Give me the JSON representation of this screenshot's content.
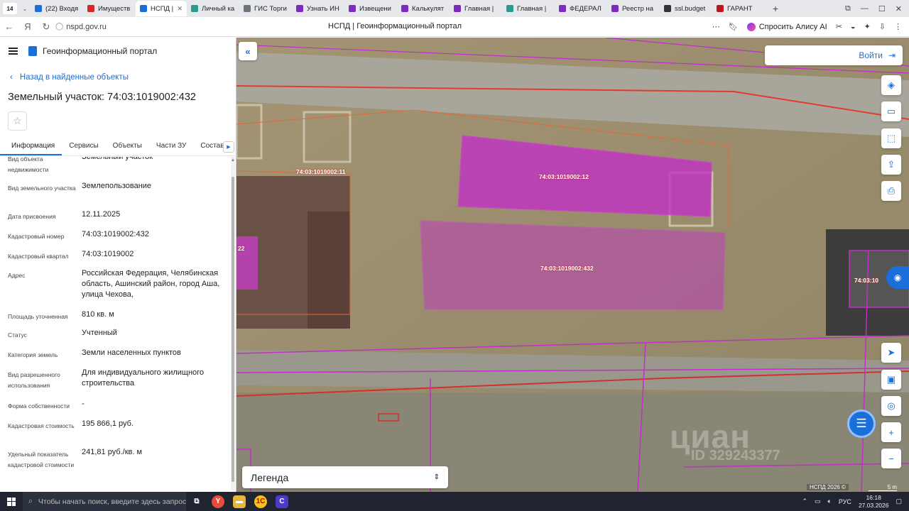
{
  "browser": {
    "tab_count": "14",
    "tabs": [
      {
        "label": "(22) Входя",
        "color": "#1a6fd8"
      },
      {
        "label": "Имуществ",
        "color": "#d62828"
      },
      {
        "label": "НСПД |",
        "color": "#1a6fd8",
        "active": true
      },
      {
        "label": "Личный ка",
        "color": "#2a9d8f"
      },
      {
        "label": "ГИС Торги",
        "color": "#6c757d"
      },
      {
        "label": "Узнать ИН",
        "color": "#7b2cbf"
      },
      {
        "label": "Извещени",
        "color": "#7b2cbf"
      },
      {
        "label": "Калькулят",
        "color": "#7b2cbf"
      },
      {
        "label": "Главная |",
        "color": "#7b2cbf"
      },
      {
        "label": "Главная |",
        "color": "#2a9d8f"
      },
      {
        "label": "ФЕДЕРАЛ",
        "color": "#7b2cbf"
      },
      {
        "label": "Реестр на",
        "color": "#7b2cbf"
      },
      {
        "label": "ssl.budget",
        "color": "#333333"
      },
      {
        "label": "ГАРАНТ",
        "color": "#c1121f"
      }
    ],
    "url": "nspd.gov.ru",
    "page_title": "НСПД | Геоинформационный портал",
    "alice_label": "Спросить Алису AI"
  },
  "panel": {
    "portal_title": "Геоинформационный портал",
    "back_label": "Назад в найденные объекты",
    "object_title": "Земельный участок: 74:03:1019002:432",
    "tabs": [
      "Информация",
      "Сервисы",
      "Объекты",
      "Части ЗУ",
      "Состав"
    ],
    "properties": [
      {
        "label": "Вид объекта недвижимости",
        "value": "Земельный участок"
      },
      {
        "label": "Вид земельного участка",
        "value": "Землепользование"
      },
      {
        "label": "Дата присвоения",
        "value": "12.11.2025"
      },
      {
        "label": "Кадастровый номер",
        "value": "74:03:1019002:432"
      },
      {
        "label": "Кадастровый квартал",
        "value": "74:03:1019002"
      },
      {
        "label": "Адрес",
        "value": "Российская Федерация, Челябинская область, Ашинский район, город Аша, улица Чехова,"
      },
      {
        "label": "Площадь уточненная",
        "value": "810 кв. м"
      },
      {
        "label": "Статус",
        "value": "Учтенный"
      },
      {
        "label": "Категория земель",
        "value": "Земли населенных пунктов"
      },
      {
        "label": "Вид разрешенного использования",
        "value": "Для индивидуального жилищного строительства"
      },
      {
        "label": "Форма собственности",
        "value": "-"
      },
      {
        "label": "Кадастровая стоимость",
        "value": "195 866,1 руб."
      },
      {
        "label": "Удельный показатель кадастровой стоимости",
        "value": "241,81 руб./кв. м"
      }
    ]
  },
  "map": {
    "login_label": "Войти",
    "legend_label": "Легенда",
    "parcel_labels": [
      "74:03:1019002:11",
      "74:03:1019002:12",
      "74:03:1019002:432",
      "22",
      "74:03:10"
    ],
    "watermark": "циан",
    "watermark_id": "ID 329243377",
    "attribution": "НСПД 2026 ©",
    "scale_label": "5 m"
  },
  "taskbar": {
    "search_placeholder": "Чтобы начать поиск, введите здесь запрос",
    "lang": "РУС",
    "time": "16:18",
    "date": "27.03.2026"
  }
}
